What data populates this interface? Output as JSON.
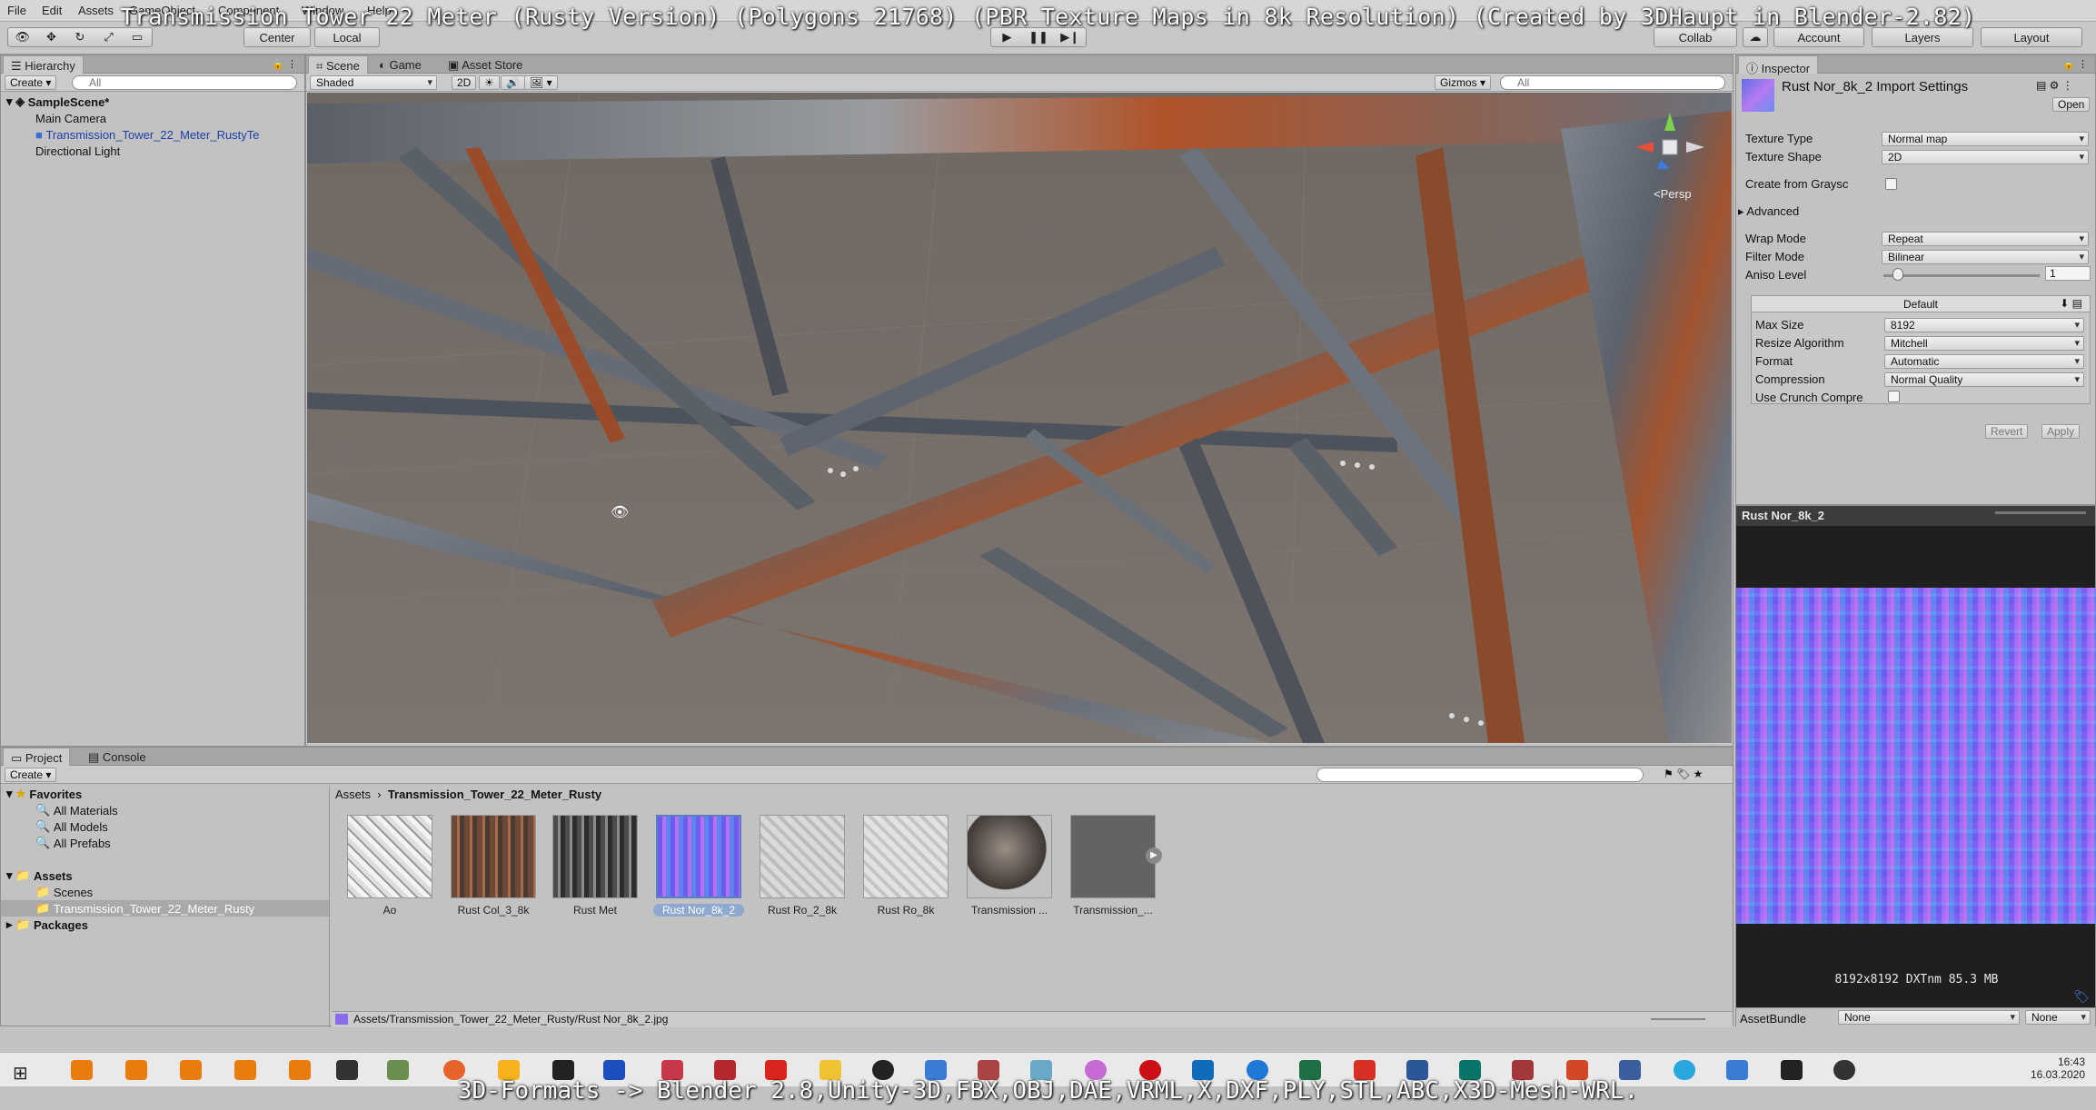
{
  "overlay": {
    "title": "Transmission Tower 22 Meter (Rusty Version) (Polygons 21768) (PBR Texture Maps in 8k Resolution) (Created by 3DHaupt in Blender-2.82)",
    "bottom": "3D-Formats -> Blender 2.8,Unity-3D,FBX,OBJ,DAE,VRML,X,DXF,PLY,STL,ABC,X3D-Mesh-WRL."
  },
  "menu": [
    "File",
    "Edit",
    "Assets",
    "GameObject",
    "Component",
    "Window",
    "Help"
  ],
  "toolbar": {
    "pivot": "Center",
    "space": "Local",
    "collab": "Collab",
    "account": "Account",
    "layers": "Layers",
    "layout": "Layout"
  },
  "hierarchy": {
    "tab": "Hierarchy",
    "create": "Create",
    "search_placeholder": "All",
    "scene": "SampleScene*",
    "items": [
      "Main Camera",
      "Transmission_Tower_22_Meter_RustyTe",
      "Directional Light"
    ]
  },
  "scene_tabs": [
    "Scene",
    "Game",
    "Asset Store"
  ],
  "scene_bar": {
    "shading": "Shaded",
    "mode2d": "2D",
    "gizmos": "Gizmos",
    "search_placeholder": "All",
    "persp": "<Persp"
  },
  "inspector": {
    "tab": "Inspector",
    "asset_title": "Rust Nor_8k_2 Import Settings",
    "open": "Open",
    "texture_type_label": "Texture Type",
    "texture_type": "Normal map",
    "texture_shape_label": "Texture Shape",
    "texture_shape": "2D",
    "create_from_grayscale": "Create from Graysc",
    "advanced": "Advanced",
    "wrap_mode_label": "Wrap Mode",
    "wrap_mode": "Repeat",
    "filter_mode_label": "Filter Mode",
    "filter_mode": "Bilinear",
    "aniso_label": "Aniso Level",
    "aniso_value": "1",
    "aniso_fraction": 0.06,
    "platform": "Default",
    "max_size_label": "Max Size",
    "max_size": "8192",
    "resize_label": "Resize Algorithm",
    "resize": "Mitchell",
    "format_label": "Format",
    "format": "Automatic",
    "compression_label": "Compression",
    "compression": "Normal Quality",
    "crunch_label": "Use Crunch Compre",
    "revert": "Revert",
    "apply": "Apply"
  },
  "preview": {
    "title": "Rust Nor_8k_2",
    "info": "8192x8192  DXTnm  85.3 MB",
    "assetbundle_label": "AssetBundle",
    "assetbundle": "None",
    "variant": "None"
  },
  "project": {
    "tabs": [
      "Project",
      "Console"
    ],
    "create": "Create",
    "favorites": "Favorites",
    "favorite_items": [
      "All Materials",
      "All Models",
      "All Prefabs"
    ],
    "assets": "Assets",
    "asset_folders": [
      "Scenes",
      "Transmission_Tower_22_Meter_Rusty"
    ],
    "packages": "Packages",
    "breadcrumb_root": "Assets",
    "breadcrumb_current": "Transmission_Tower_22_Meter_Rusty",
    "items": [
      "Ao",
      "Rust Col_3_8k",
      "Rust Met",
      "Rust Nor_8k_2",
      "Rust Ro_2_8k",
      "Rust Ro_8k",
      "Transmission ...",
      "Transmission_..."
    ],
    "status_path": "Assets/Transmission_Tower_22_Meter_Rusty/Rust Nor_8k_2.jpg"
  },
  "taskbar": {
    "time": "16:43",
    "date": "16.03.2020"
  },
  "colors": {
    "selection": "#8ea8d0",
    "rust": "#b0532a",
    "normal_map": "#8a6cf0"
  }
}
